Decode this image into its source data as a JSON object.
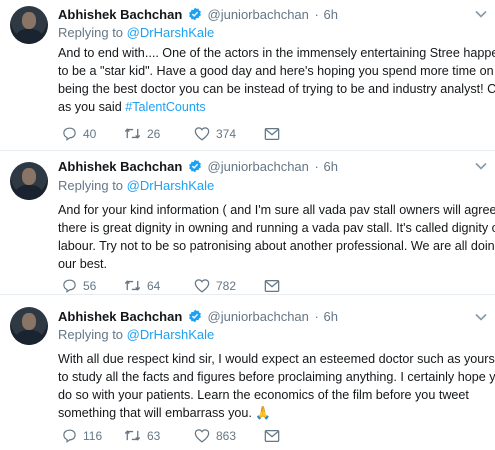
{
  "tweets": [
    {
      "author_name": "Abhishek Bachchan",
      "handle": "@juniorbachchan",
      "dot": "·",
      "time": "6h",
      "replying_label": "Replying to",
      "replying_to": "@DrHarshKale",
      "lines": [
        "And to end with.... One of the actors in the immensely entertaining Stree happens",
        "to be a \"star kid\". Have a good day and here's hoping you spend more time on",
        "being the best doctor you can be instead of trying to be and industry analyst! Coz",
        "as you said "
      ],
      "hashtag": "#TalentCounts",
      "replies": "40",
      "retweets": "26",
      "likes": "374"
    },
    {
      "author_name": "Abhishek Bachchan",
      "handle": "@juniorbachchan",
      "dot": "·",
      "time": "6h",
      "replying_label": "Replying to",
      "replying_to": "@DrHarshKale",
      "lines": [
        "And for your kind information ( and I'm sure all vada pav stall owners will agree)",
        "there is great dignity in owning and running a vada pav stall. It's called dignity of",
        "labour. Try not to be so patronising about another professional. We are all doing",
        "our best."
      ],
      "replies": "56",
      "retweets": "64",
      "likes": "782"
    },
    {
      "author_name": "Abhishek Bachchan",
      "handle": "@juniorbachchan",
      "dot": "·",
      "time": "6h",
      "replying_label": "Replying to",
      "replying_to": "@DrHarshKale",
      "lines": [
        "With all due respect kind sir, I would expect an esteemed doctor such as yourself",
        "to study all the facts and figures before proclaiming anything. I certainly hope you",
        "do so with your patients. Learn the economics of the film before you tweet",
        "something that will embarrass you. "
      ],
      "emoji": "🙏",
      "replies": "116",
      "retweets": "63",
      "likes": "863"
    }
  ],
  "icons": [
    "avatar",
    "verified-badge-icon",
    "chevron-down-icon",
    "reply-icon",
    "retweet-icon",
    "like-icon",
    "direct-message-icon"
  ],
  "colors": {
    "link": "#1da1f2",
    "muted": "#657786",
    "text": "#14171a",
    "divider": "#e6ecf0"
  }
}
